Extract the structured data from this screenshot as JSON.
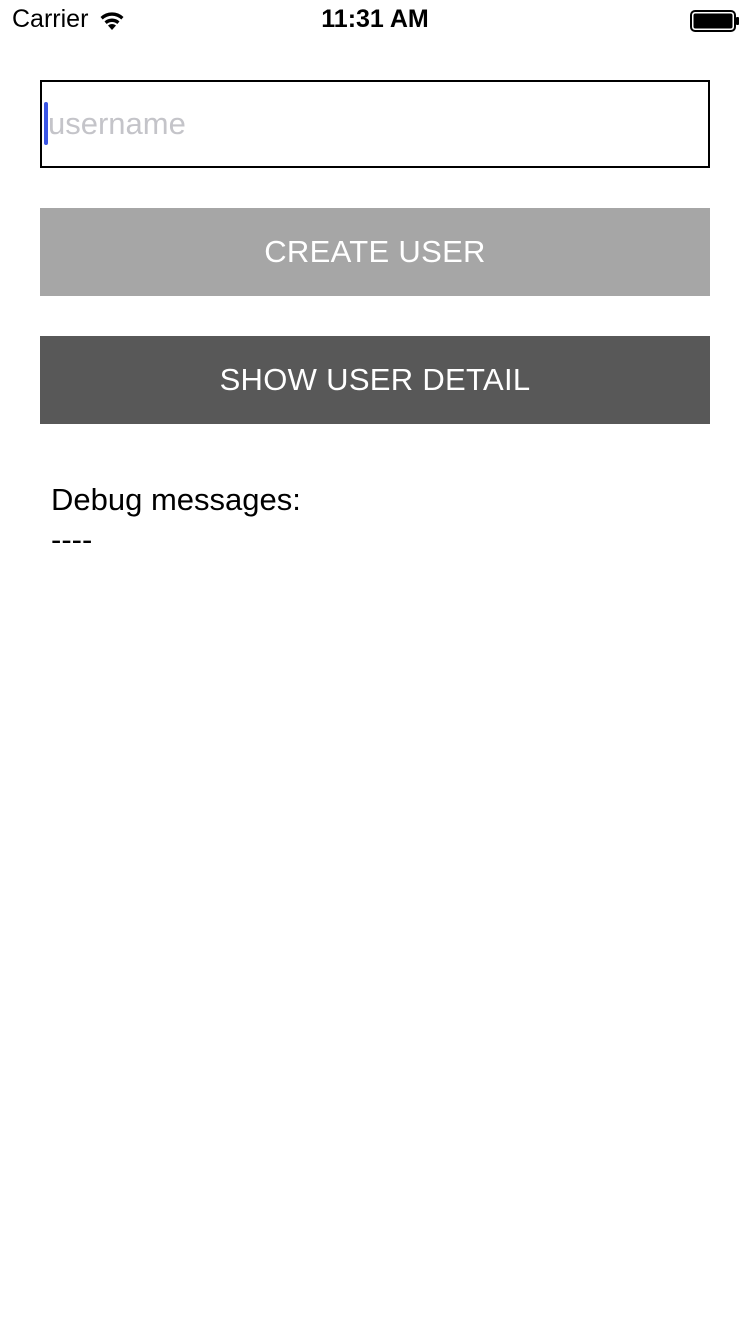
{
  "status_bar": {
    "carrier": "Carrier",
    "time": "11:31 AM",
    "wifi_icon": "wifi-icon",
    "battery_icon": "battery-full-icon"
  },
  "username_field": {
    "value": "",
    "placeholder": "username"
  },
  "buttons": {
    "create_user": "CREATE USER",
    "show_user_detail": "SHOW USER DETAIL"
  },
  "debug": {
    "title": "Debug messages:",
    "separator": "----"
  },
  "colors": {
    "create_button_bg": "#a6a6a6",
    "show_button_bg": "#585858",
    "cursor": "#3a55e4",
    "placeholder": "#c4c4c9"
  }
}
